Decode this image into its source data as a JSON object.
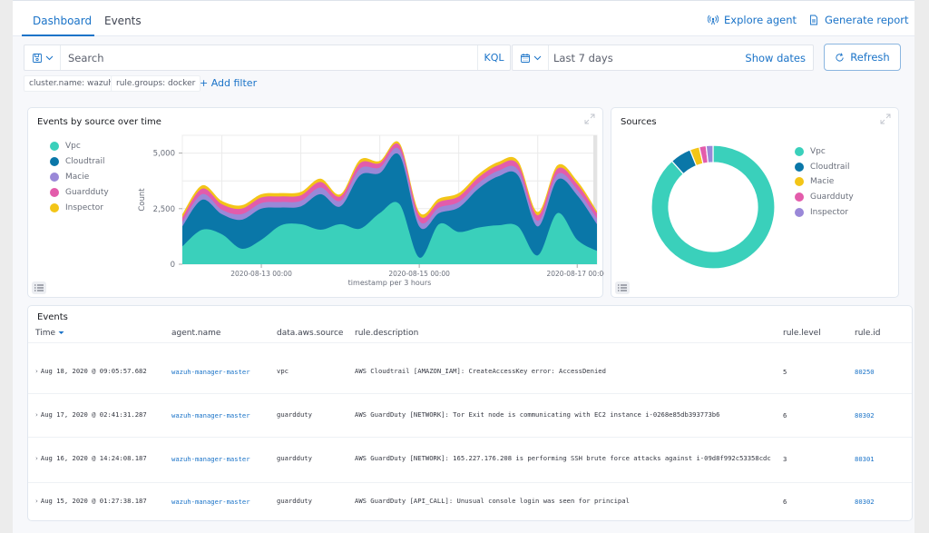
{
  "tabs": [
    {
      "label": "Dashboard",
      "active": true
    },
    {
      "label": "Events",
      "active": false
    }
  ],
  "actions": {
    "explore_agent": "Explore agent",
    "generate_report": "Generate report"
  },
  "search": {
    "placeholder": "Search",
    "language": "KQL"
  },
  "date_picker": {
    "range": "Last 7 days",
    "show_dates": "Show dates"
  },
  "refresh_label": "Refresh",
  "filters": [
    {
      "label": "cluster.name: wazuh"
    },
    {
      "label": "rule.groups: docker"
    }
  ],
  "add_filter_label": "+ Add filter",
  "colors": {
    "vpc": "#3ad0bb",
    "cloudtrail": "#0a77a8",
    "macie": "#9a88d8",
    "guardduty": "#e35cab",
    "inspector": "#f3c517",
    "accent": "#1a73c8"
  },
  "chart_data": [
    {
      "type": "area",
      "stacked": true,
      "title": "Events by source over time",
      "xlabel": "timestamp per 3 hours",
      "ylabel": "Count",
      "ylim": [
        0,
        5800
      ],
      "y_ticks": [
        "0",
        "2,500",
        "5,000"
      ],
      "y_tick_values": [
        0,
        2500,
        5000
      ],
      "x_ticks": [
        "2020-08-13 00:00",
        "2020-08-15 00:00",
        "2020-08-17 00:00"
      ],
      "x_tick_positions": [
        4,
        12,
        20
      ],
      "legend_position": "left",
      "x": [
        0,
        1,
        2,
        3,
        4,
        5,
        6,
        7,
        8,
        9,
        10,
        11,
        12,
        13,
        14,
        15,
        16,
        17,
        18,
        19,
        20,
        21
      ],
      "series": [
        {
          "name": "Vpc",
          "values": [
            800,
            1550,
            1350,
            700,
            1100,
            1750,
            1800,
            1550,
            1800,
            1600,
            2300,
            2700,
            300,
            1800,
            1450,
            1650,
            1750,
            1700,
            400,
            2300,
            1100,
            600
          ]
        },
        {
          "name": "Cloudtrail",
          "values": [
            900,
            1350,
            900,
            1300,
            1400,
            800,
            800,
            1600,
            800,
            2400,
            1800,
            2200,
            1400,
            500,
            1100,
            1750,
            2200,
            2300,
            1300,
            1500,
            2000,
            1200
          ]
        },
        {
          "name": "Macie",
          "values": [
            200,
            250,
            200,
            250,
            250,
            250,
            250,
            300,
            250,
            300,
            250,
            250,
            250,
            250,
            250,
            250,
            250,
            250,
            250,
            250,
            250,
            250
          ]
        },
        {
          "name": "Guardduty",
          "values": [
            200,
            250,
            250,
            250,
            250,
            250,
            250,
            250,
            200,
            250,
            200,
            200,
            250,
            250,
            250,
            250,
            250,
            250,
            250,
            250,
            250,
            250
          ]
        },
        {
          "name": "Inspector",
          "values": [
            150,
            150,
            150,
            150,
            150,
            150,
            150,
            150,
            100,
            150,
            100,
            100,
            150,
            150,
            150,
            150,
            150,
            150,
            150,
            150,
            150,
            100
          ]
        }
      ]
    },
    {
      "type": "pie",
      "donut": true,
      "title": "Sources",
      "legend_position": "right",
      "categories": [
        "Vpc",
        "Cloudtrail",
        "Macie",
        "Guardduty",
        "Inspector"
      ],
      "values": [
        88,
        5.5,
        2.5,
        1.8,
        1.8
      ]
    }
  ],
  "events": {
    "title": "Events",
    "columns": [
      "Time",
      "agent.name",
      "data.aws.source",
      "rule.description",
      "rule.level",
      "rule.id"
    ],
    "sort_column": "Time",
    "rows": [
      {
        "time": "Aug 18, 2020 @ 09:05:57.682",
        "agent": "wazuh-manager-master",
        "source": "vpc",
        "description": "AWS Cloudtrail [AMAZON_IAM]: CreateAccessKey error: AccessDenied",
        "level": "5",
        "rule_id": "80250"
      },
      {
        "time": "Aug 17, 2020 @ 02:41:31.287",
        "agent": "wazuh-manager-master",
        "source": "guardduty",
        "description": "AWS GuardDuty [NETWORK]: Tor Exit node is communicating with EC2 instance i-0268e85db393773b6",
        "level": "6",
        "rule_id": "80302"
      },
      {
        "time": "Aug 16, 2020 @ 14:24:08.187",
        "agent": "wazuh-manager-master",
        "source": "guardduty",
        "description": "AWS GuardDuty [NETWORK]: 165.227.176.208 is performing SSH brute force attacks against i-09d8f992c53358cdc",
        "level": "3",
        "rule_id": "80301"
      },
      {
        "time": "Aug 15, 2020 @ 01:27:38.187",
        "agent": "wazuh-manager-master",
        "source": "guardduty",
        "description": "AWS GuardDuty [API_CALL]: Unusual console login was seen for principal",
        "level": "6",
        "rule_id": "80302"
      }
    ]
  }
}
